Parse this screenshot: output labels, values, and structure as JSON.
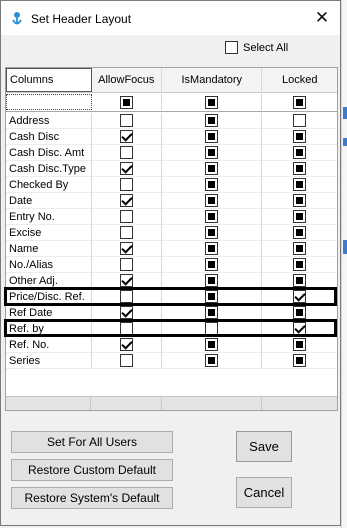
{
  "window": {
    "title": "Set Header Layout",
    "close_glyph": "✕"
  },
  "select_all": {
    "label": "Select All",
    "checked": false
  },
  "grid": {
    "headers": [
      "Columns",
      "AllowFocus",
      "IsMandatory",
      "Locked"
    ],
    "filter_row": [
      "",
      "square",
      "square",
      "square"
    ],
    "rows": [
      {
        "name": "Address",
        "allow": "empty",
        "mand": "square",
        "lock": "empty"
      },
      {
        "name": "Cash Disc",
        "allow": "check",
        "mand": "square",
        "lock": "square"
      },
      {
        "name": "Cash Disc. Amt",
        "allow": "empty",
        "mand": "square",
        "lock": "square"
      },
      {
        "name": "Cash Disc.Type",
        "allow": "check",
        "mand": "square",
        "lock": "square"
      },
      {
        "name": "Checked By",
        "allow": "empty",
        "mand": "square",
        "lock": "square"
      },
      {
        "name": "Date",
        "allow": "check",
        "mand": "square",
        "lock": "square"
      },
      {
        "name": "Entry No.",
        "allow": "empty",
        "mand": "square",
        "lock": "square"
      },
      {
        "name": "Excise",
        "allow": "empty",
        "mand": "square",
        "lock": "square"
      },
      {
        "name": "Name",
        "allow": "check",
        "mand": "square",
        "lock": "square"
      },
      {
        "name": "No./Alias",
        "allow": "empty",
        "mand": "square",
        "lock": "square"
      },
      {
        "name": "Other Adj.",
        "allow": "check",
        "mand": "square",
        "lock": "square"
      },
      {
        "name": "Price/Disc. Ref.",
        "allow": "empty",
        "mand": "square",
        "lock": "check"
      },
      {
        "name": "Ref Date",
        "allow": "check",
        "mand": "square",
        "lock": "square"
      },
      {
        "name": "Ref. by",
        "allow": "empty",
        "mand": "empty",
        "lock": "check"
      },
      {
        "name": "Ref. No.",
        "allow": "check",
        "mand": "square",
        "lock": "square"
      },
      {
        "name": "Series",
        "allow": "empty",
        "mand": "square",
        "lock": "square"
      }
    ]
  },
  "buttons": {
    "set_for_all": "Set For All Users",
    "restore_custom": "Restore Custom Default",
    "restore_system": "Restore System's Default",
    "save": "Save",
    "cancel": "Cancel"
  },
  "colors": {
    "accent": "#3a7bd5",
    "highlight_border": "#000000"
  }
}
